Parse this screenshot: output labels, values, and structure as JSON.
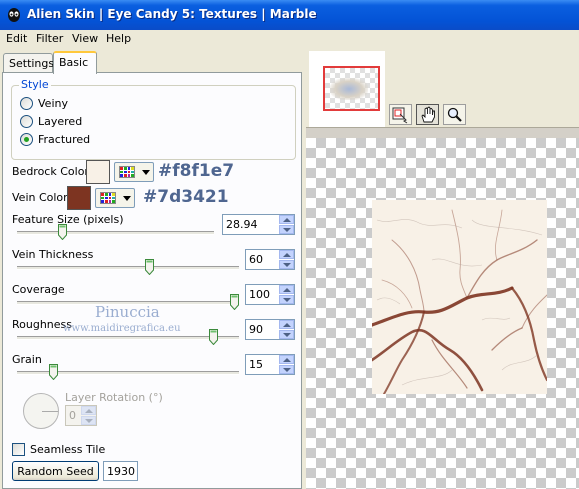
{
  "window": {
    "title": "Alien Skin | Eye Candy 5: Textures | Marble"
  },
  "menu": [
    "Edit",
    "Filter",
    "View",
    "Help"
  ],
  "tabs": [
    {
      "label": "Settings",
      "active": false
    },
    {
      "label": "Basic",
      "active": true
    }
  ],
  "style_group": {
    "label": "Style",
    "options": [
      {
        "label": "Veiny",
        "selected": false
      },
      {
        "label": "Layered",
        "selected": false
      },
      {
        "label": "Fractured",
        "selected": true
      }
    ]
  },
  "bedrock_color": {
    "label": "Bedrock Color",
    "hex_text": "#f8f1e7",
    "color": "#f8f1e7"
  },
  "vein_color": {
    "label": "Vein Color",
    "hex_text": "#7d3421",
    "color": "#7d3421"
  },
  "sliders": [
    {
      "label": "Feature Size (pixels)",
      "value": "28.94",
      "fraction": 0.22
    },
    {
      "label": "Vein Thickness",
      "value": "60",
      "fraction": 0.6
    },
    {
      "label": "Coverage",
      "value": "100",
      "fraction": 1.0
    },
    {
      "label": "Roughness",
      "value": "90",
      "fraction": 0.9
    },
    {
      "label": "Grain",
      "value": "15",
      "fraction": 0.15
    }
  ],
  "layer_rotation": {
    "label": "Layer Rotation (°)",
    "value": "0",
    "enabled": false
  },
  "seamless_tile": {
    "label": "Seamless Tile",
    "checked": false
  },
  "random_seed": {
    "button_label": "Random Seed",
    "value": "1930"
  },
  "watermark": {
    "name": "Pinuccia",
    "url": "www.maidiregrafica.eu"
  },
  "colors": {
    "title_blue": "#0453d6",
    "group_label_blue": "#0046d5",
    "hex_text_color": "#4f6690",
    "radio_selected": "#21a121",
    "nav_frame": "#e23b3b"
  },
  "icons": {
    "app": "alien-skin-icon",
    "tools": [
      "navigate-preview-icon",
      "hand-pan-icon",
      "zoom-magnifier-icon"
    ]
  }
}
